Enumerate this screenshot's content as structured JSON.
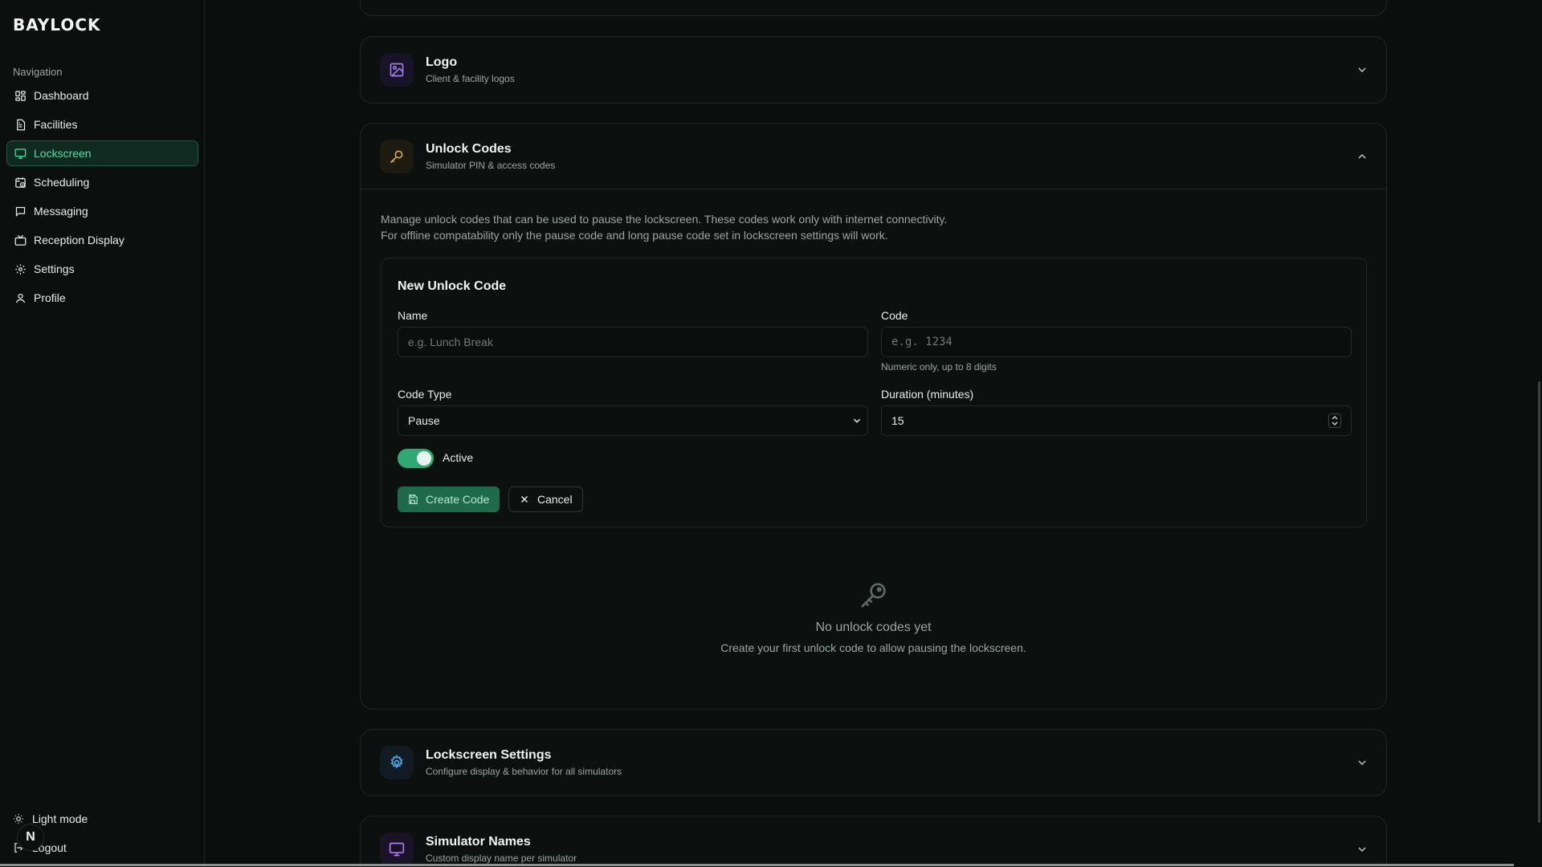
{
  "brand": "BAYLOCK",
  "sidebar": {
    "heading": "Navigation",
    "items": [
      {
        "label": "Dashboard"
      },
      {
        "label": "Facilities"
      },
      {
        "label": "Lockscreen"
      },
      {
        "label": "Scheduling"
      },
      {
        "label": "Messaging"
      },
      {
        "label": "Reception Display"
      },
      {
        "label": "Settings"
      },
      {
        "label": "Profile"
      }
    ],
    "active": "Lockscreen",
    "light_mode": "Light mode",
    "logout": "Logout",
    "avatar_letter": "N"
  },
  "sections": {
    "logo": {
      "title": "Logo",
      "subtitle": "Client & facility logos"
    },
    "unlock": {
      "title": "Unlock Codes",
      "subtitle": "Simulator PIN & access codes",
      "desc_line1": "Manage unlock codes that can be used to pause the lockscreen. These codes work only with internet connectivity.",
      "desc_line2": "For offline compatability only the pause code and long pause code set in lockscreen settings will work."
    },
    "lockscreen_settings": {
      "title": "Lockscreen Settings",
      "subtitle": "Configure display & behavior for all simulators"
    },
    "simulator_names": {
      "title": "Simulator Names",
      "subtitle": "Custom display name per simulator"
    }
  },
  "form": {
    "title": "New Unlock Code",
    "name_label": "Name",
    "name_placeholder": "e.g. Lunch Break",
    "code_label": "Code",
    "code_placeholder": "e.g. 1234",
    "code_hint": "Numeric only, up to 8 digits",
    "type_label": "Code Type",
    "type_value": "Pause",
    "duration_label": "Duration (minutes)",
    "duration_value": "15",
    "active_label": "Active",
    "active": true,
    "create_label": "Create Code",
    "cancel_label": "Cancel"
  },
  "empty": {
    "title": "No unlock codes yet",
    "subtitle": "Create your first unlock code to allow pausing the lockscreen."
  },
  "colors": {
    "accent": "#4ee0a3",
    "active_bg": "#0f2a21",
    "create_button": "#1e6a4a",
    "logo_icon": "#a07ce6",
    "unlock_icon": "#d9a84a",
    "settings_icon": "#4fa8e8",
    "simulator_icon": "#b37af0"
  },
  "icons": {
    "logo": "image-icon",
    "unlock": "key-icon",
    "settings": "gear-icon",
    "simulator": "monitor-icon"
  }
}
